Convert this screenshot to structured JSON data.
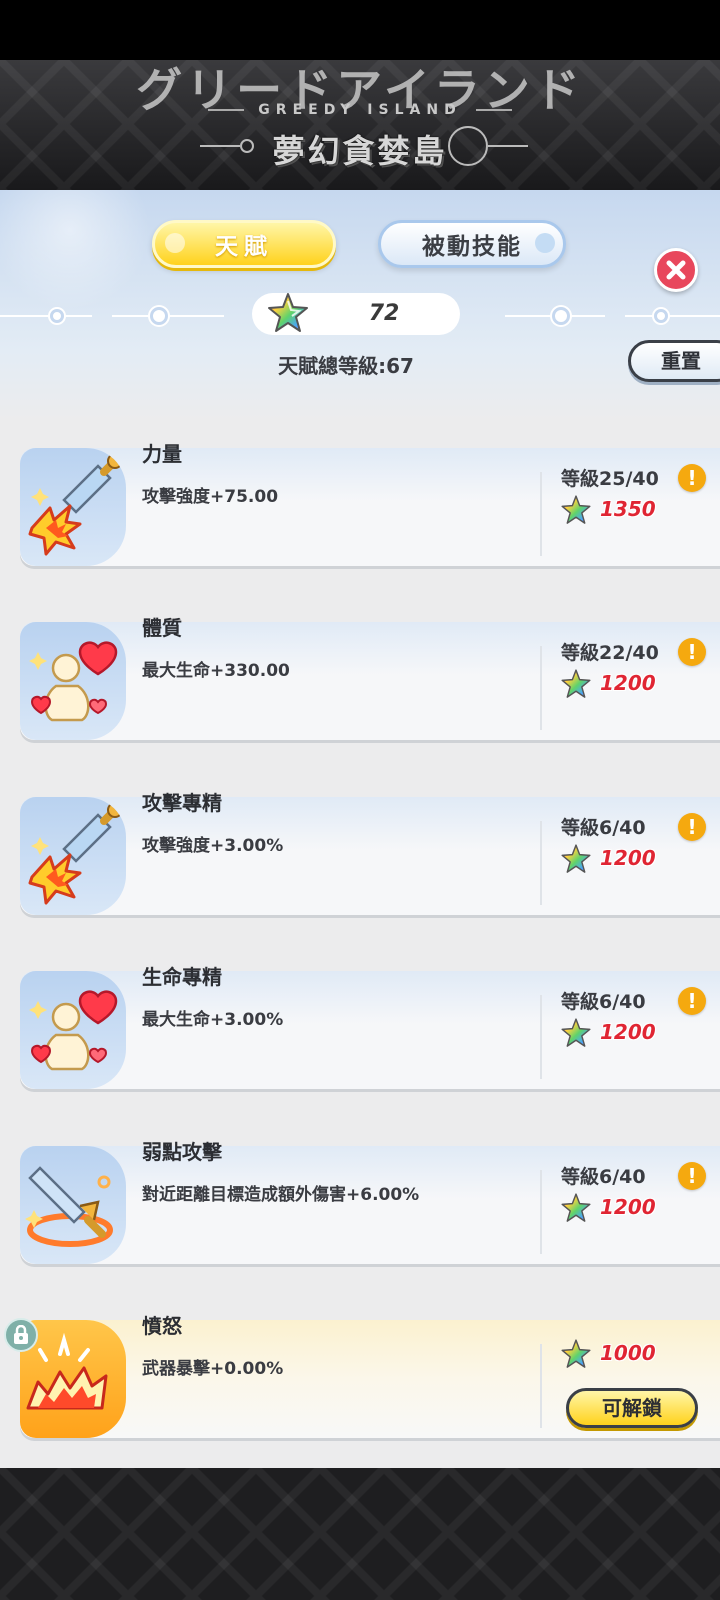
{
  "banner": {
    "logo_kana": "グリードアイランド",
    "logo_en": "GREEDY ISLAND",
    "logo_cn": "夢幻貪婪島"
  },
  "tabs": [
    {
      "label": "天賦",
      "selected": true
    },
    {
      "label": "被動技能",
      "selected": false
    }
  ],
  "points": {
    "icon": "rainbow-star-icon",
    "value": "72"
  },
  "total_level": "天賦總等級:67",
  "reset_label": "重置",
  "talents": [
    {
      "name": "力量",
      "desc": "攻擊強度+75.00",
      "level": "等級25/40",
      "cost": "1350",
      "icon": "sword-strike-icon"
    },
    {
      "name": "體質",
      "desc": "最大生命+330.00",
      "level": "等級22/40",
      "cost": "1200",
      "icon": "heart-figure-icon"
    },
    {
      "name": "攻擊專精",
      "desc": "攻擊強度+3.00%",
      "level": "等級6/40",
      "cost": "1200",
      "icon": "sword-strike-icon"
    },
    {
      "name": "生命專精",
      "desc": "最大生命+3.00%",
      "level": "等級6/40",
      "cost": "1200",
      "icon": "heart-figure-icon"
    },
    {
      "name": "弱點攻擊",
      "desc": "對近距離目標造成額外傷害+6.00%",
      "level": "等級6/40",
      "cost": "1200",
      "icon": "sword-ring-icon"
    },
    {
      "name": "憤怒",
      "desc": "武器暴擊+0.00%",
      "cost": "1000",
      "icon": "rage-burst-icon",
      "locked": true,
      "unlock_label": "可解鎖"
    }
  ],
  "colors": {
    "accent_yellow": "#ffd21c",
    "cost_red": "#e02533",
    "close_red": "#e8475c",
    "info_orange": "#f5a90f"
  }
}
